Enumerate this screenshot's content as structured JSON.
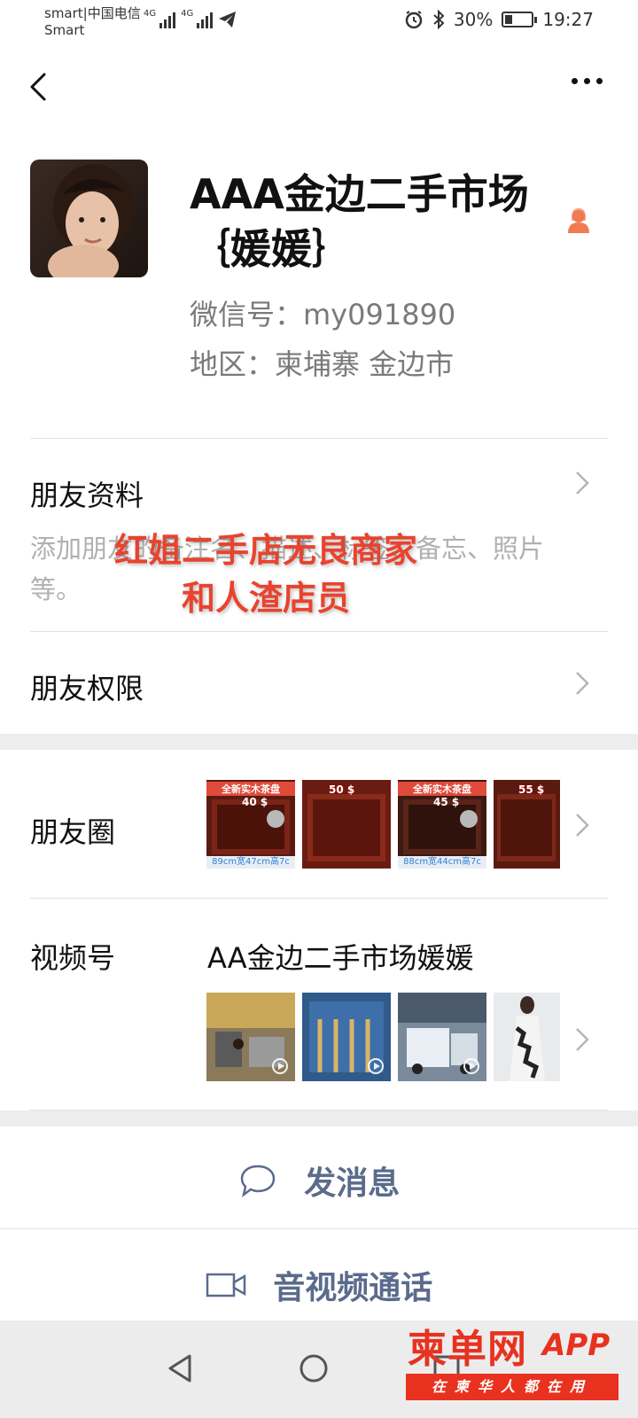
{
  "status_bar": {
    "carrier_line1": "smart|中国电信",
    "carrier_line2": "Smart",
    "signal1_label": "4G",
    "signal2_label": "4G",
    "battery_percent": "30%",
    "battery_level": 0.3,
    "time": "19:27"
  },
  "nav": {
    "back_icon": "chevron-left-icon",
    "more_icon": "more-dots-icon"
  },
  "profile": {
    "name": "AAA金边二手市场｛媛媛｝",
    "wechat_id": "微信号：my091890",
    "region": "地区：柬埔寨  金边市",
    "sex_icon_color": "#f07b52"
  },
  "friend_info": {
    "title": "朋友资料",
    "hint": "添加朋友的备注名、描述、标签、备忘、照片等。"
  },
  "watermark": {
    "line1": "红姐二手店无良商家",
    "line2": "和人渣店员"
  },
  "permissions": {
    "title": "朋友权限"
  },
  "moments": {
    "title": "朋友圈",
    "thumbs": [
      {
        "caption": "全新实木茶盘",
        "price": "40 $",
        "dims": "89cm宽47cm高7c"
      },
      {
        "caption": "",
        "price": "50 $",
        "dims": ""
      },
      {
        "caption": "全新实木茶盘",
        "price": "45 $",
        "dims": "88cm宽44cm高7c"
      },
      {
        "caption": "",
        "price": "55 $",
        "dims": ""
      }
    ]
  },
  "channels": {
    "title": "视频号",
    "name": "AA金边二手市场媛媛"
  },
  "actions": {
    "message": "发消息",
    "call": "音视频通话"
  },
  "brand": {
    "name": "柬单网",
    "suffix": "APP",
    "slogan": "在柬华人都在用"
  },
  "colors": {
    "accent_text": "#5b6b8c",
    "watermark": "#e8432e",
    "brand": "#e8321f"
  }
}
